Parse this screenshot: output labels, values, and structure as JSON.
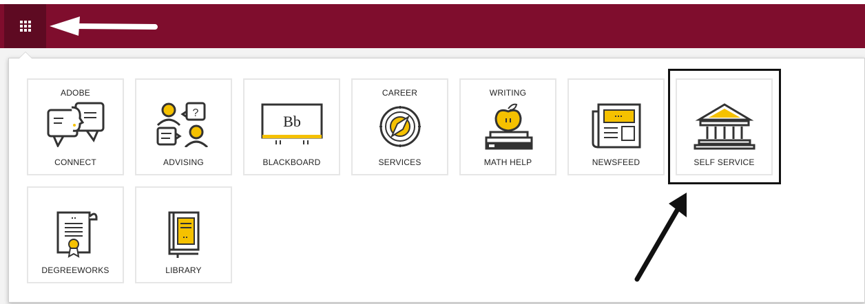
{
  "colors": {
    "topbar": "#7f0d2d",
    "accent": "#f5c100",
    "stroke": "#333333"
  },
  "toolbar": {
    "apps_icon": "grid-icon"
  },
  "tiles": [
    {
      "top": "ADOBE",
      "bottom": "CONNECT",
      "icon": "chat-faces-icon"
    },
    {
      "top": "",
      "bottom": "ADVISING",
      "icon": "advising-icon"
    },
    {
      "top": "",
      "bottom": "BLACKBOARD",
      "icon": "blackboard-icon",
      "icon_text": "Bb"
    },
    {
      "top": "CAREER",
      "bottom": "SERVICES",
      "icon": "compass-icon"
    },
    {
      "top": "WRITING",
      "bottom": "MATH HELP",
      "icon": "apple-books-icon"
    },
    {
      "top": "",
      "bottom": "NEWSFEED",
      "icon": "newspaper-icon"
    },
    {
      "top": "",
      "bottom": "SELF SERVICE",
      "icon": "building-icon"
    },
    {
      "top": "",
      "bottom": "DEGREEWORKS",
      "icon": "diploma-icon"
    },
    {
      "top": "",
      "bottom": "LIBRARY",
      "icon": "book-icon"
    }
  ]
}
